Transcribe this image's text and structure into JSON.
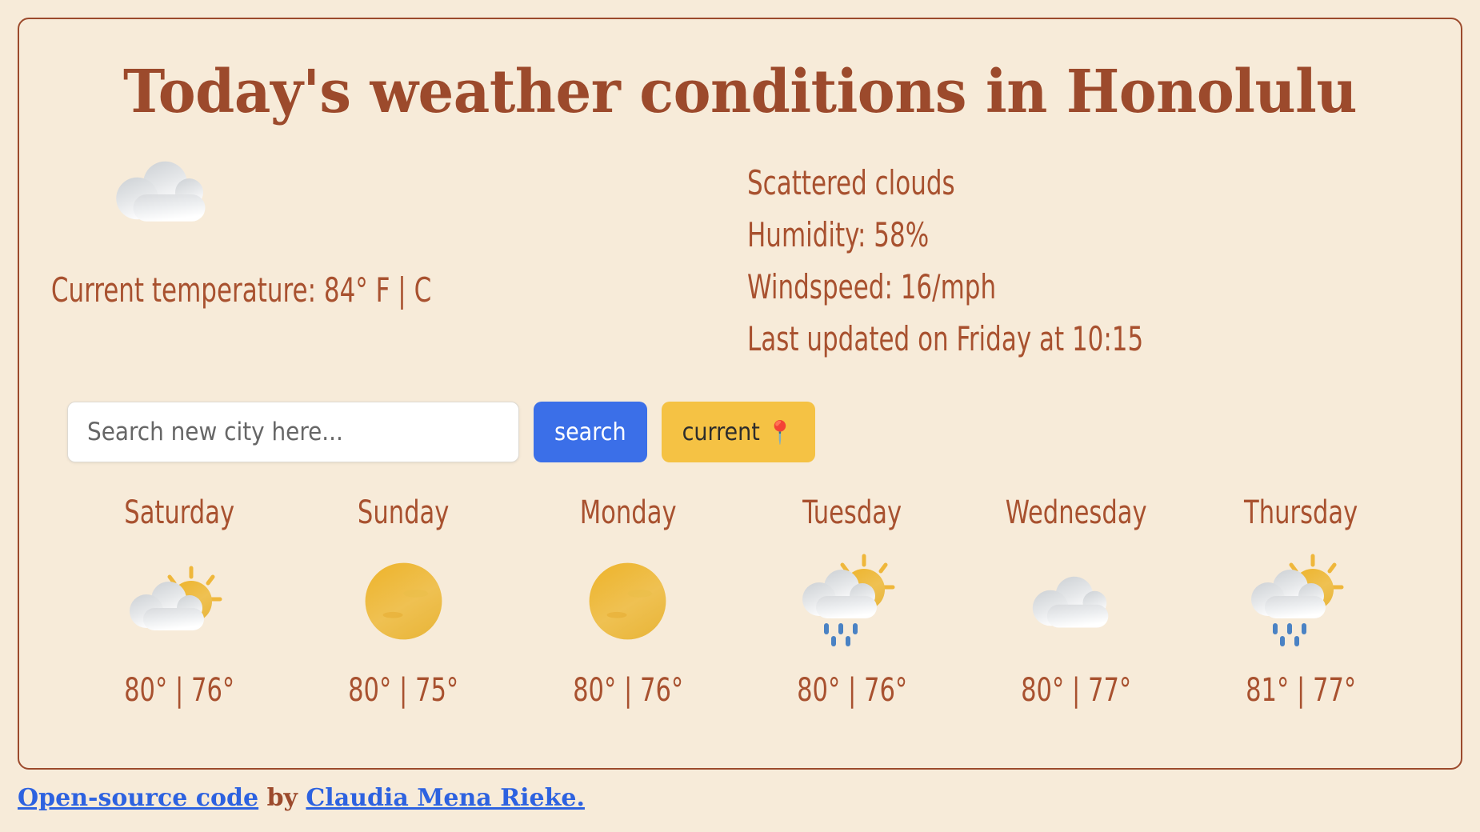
{
  "title": "Today's weather conditions in Honolulu",
  "current": {
    "icon": "cloud-icon",
    "temp_label": "Current temperature: ",
    "temp_value": "84",
    "degree": "°",
    "unit_f": "F",
    "unit_sep": " | ",
    "unit_c": "C",
    "description": "Scattered clouds",
    "humidity": "Humidity: 58%",
    "windspeed": "Windspeed: 16/mph",
    "last_updated": "Last updated on Friday at 10:15"
  },
  "search": {
    "placeholder": "Search new city here...",
    "value": "",
    "search_button": "search",
    "current_button": "current",
    "current_button_icon": "round-pushpin-icon"
  },
  "forecast": [
    {
      "day": "Saturday",
      "icon": "sun-behind-cloud-icon",
      "temps": "80° | 76°",
      "high": 80,
      "low": 76
    },
    {
      "day": "Sunday",
      "icon": "sun-icon",
      "temps": "80° | 75°",
      "high": 80,
      "low": 75
    },
    {
      "day": "Monday",
      "icon": "sun-icon",
      "temps": "80° | 76°",
      "high": 80,
      "low": 76
    },
    {
      "day": "Tuesday",
      "icon": "sun-behind-rain-cloud-icon",
      "temps": "80° | 76°",
      "high": 80,
      "low": 76
    },
    {
      "day": "Wednesday",
      "icon": "cloud-icon",
      "temps": "80° | 77°",
      "high": 80,
      "low": 77
    },
    {
      "day": "Thursday",
      "icon": "sun-behind-rain-cloud-icon",
      "temps": "81° | 77°",
      "high": 81,
      "low": 77
    }
  ],
  "footer": {
    "link1": "Open-source code",
    "middle": " by ",
    "link2": "Claudia Mena Rieke."
  },
  "colors": {
    "background": "#f7ebd9",
    "border": "#9c4a2c",
    "title": "#9c4a2c",
    "text": "#a8512f",
    "search_button": "#3b6fe8",
    "current_button": "#f5c244",
    "link": "#2d62e0",
    "sun": "#e8b339",
    "raindrop": "#4a82c4"
  }
}
